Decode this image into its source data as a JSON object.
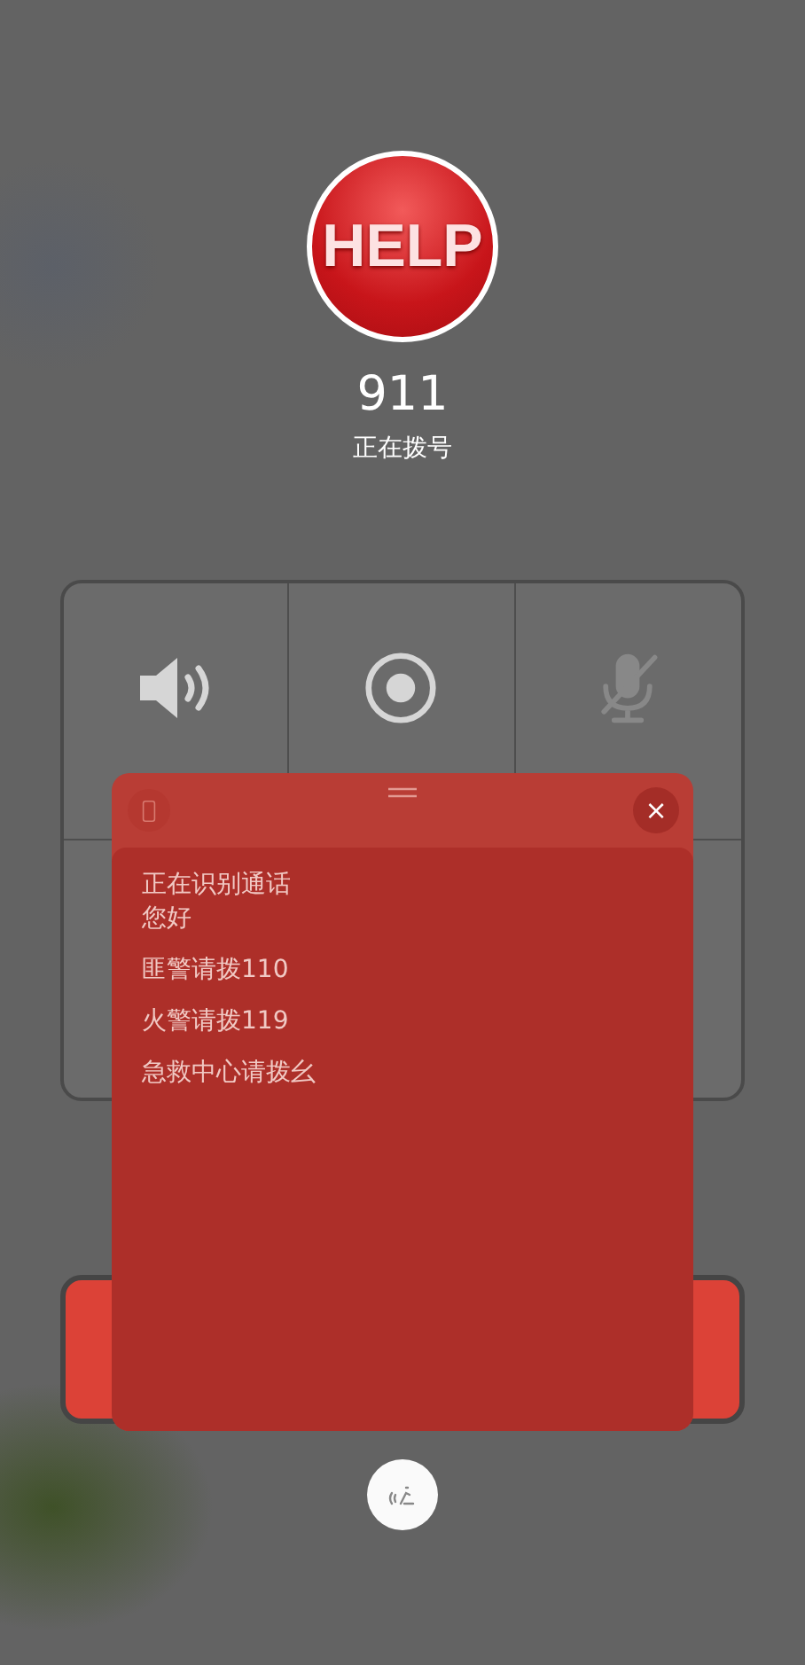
{
  "caller": {
    "logo_text": "HELP",
    "number": "911",
    "status": "正在拨号"
  },
  "controls": [
    {
      "kind": "speaker",
      "disabled": false
    },
    {
      "kind": "record",
      "disabled": false
    },
    {
      "kind": "mic",
      "disabled": true
    }
  ],
  "transcript_panel": {
    "close": "×",
    "groups": [
      [
        "正在识别通话",
        "您好"
      ],
      [
        "匪警请拨110"
      ],
      [
        "火警请拨119"
      ],
      [
        "急救中心请拨幺"
      ]
    ]
  }
}
